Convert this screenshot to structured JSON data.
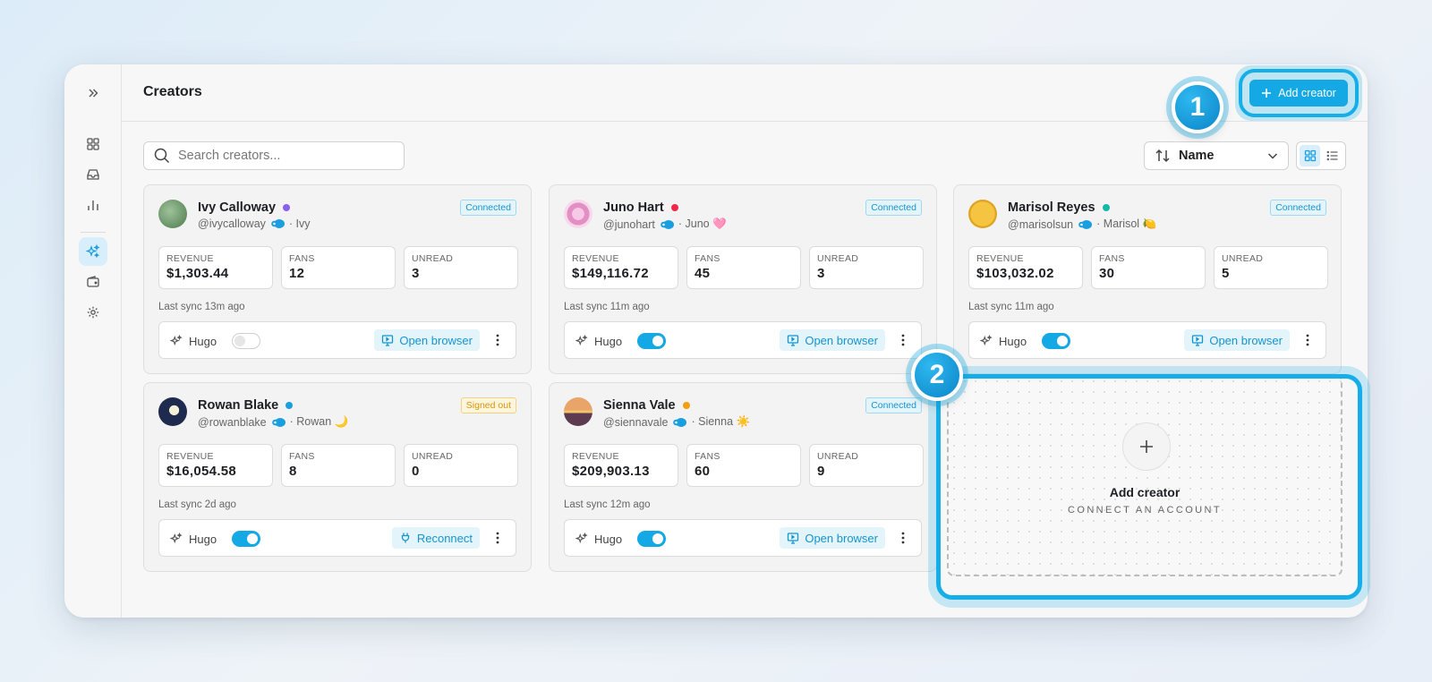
{
  "header": {
    "title": "Creators",
    "add_button_label": "Add creator"
  },
  "search": {
    "placeholder": "Search creators..."
  },
  "sort": {
    "selected": "Name"
  },
  "sidebar": {
    "items": [
      {
        "icon": "expand-icon"
      },
      {
        "icon": "dashboard-icon"
      },
      {
        "icon": "inbox-icon"
      },
      {
        "icon": "chart-icon"
      },
      {
        "icon": "sparkles-icon",
        "active": true
      },
      {
        "icon": "wallet-icon"
      },
      {
        "icon": "settings-icon"
      }
    ]
  },
  "labels": {
    "revenue": "REVENUE",
    "fans": "FANS",
    "unread": "UNREAD",
    "hugo": "Hugo"
  },
  "creators": [
    {
      "name": "Ivy Calloway",
      "handle": "@ivycalloway",
      "alias": "· Ivy",
      "dot_color": "#8b5cf6",
      "status": "Connected",
      "revenue": "$1,303.44",
      "fans": "12",
      "unread": "3",
      "last_sync": "Last sync 13m ago",
      "hugo_on": false,
      "action": "Open browser"
    },
    {
      "name": "Juno Hart",
      "handle": "@junohart",
      "alias": "· Juno 🩷",
      "dot_color": "#f0284a",
      "status": "Connected",
      "revenue": "$149,116.72",
      "fans": "45",
      "unread": "3",
      "last_sync": "Last sync 11m ago",
      "hugo_on": true,
      "action": "Open browser"
    },
    {
      "name": "Marisol Reyes",
      "handle": "@marisolsun",
      "alias": "· Marisol 🍋",
      "dot_color": "#14b8a6",
      "status": "Connected",
      "revenue": "$103,032.02",
      "fans": "30",
      "unread": "5",
      "last_sync": "Last sync 11m ago",
      "hugo_on": true,
      "action": "Open browser"
    },
    {
      "name": "Rowan Blake",
      "handle": "@rowanblake",
      "alias": "· Rowan 🌙",
      "dot_color": "#1a9ee0",
      "status": "Signed out",
      "revenue": "$16,054.58",
      "fans": "8",
      "unread": "0",
      "last_sync": "Last sync 2d ago",
      "hugo_on": true,
      "action": "Reconnect"
    },
    {
      "name": "Sienna Vale",
      "handle": "@siennavale",
      "alias": "· Sienna ☀️",
      "dot_color": "#f59e0b",
      "status": "Connected",
      "revenue": "$209,903.13",
      "fans": "60",
      "unread": "9",
      "last_sync": "Last sync 12m ago",
      "hugo_on": true,
      "action": "Open browser"
    }
  ],
  "add_card": {
    "title": "Add creator",
    "subtitle": "CONNECT AN ACCOUNT"
  },
  "callouts": [
    "1",
    "2"
  ],
  "colors": {
    "accent": "#14a8e5",
    "connected": "#1595cf",
    "signed_out": "#d6960e"
  }
}
